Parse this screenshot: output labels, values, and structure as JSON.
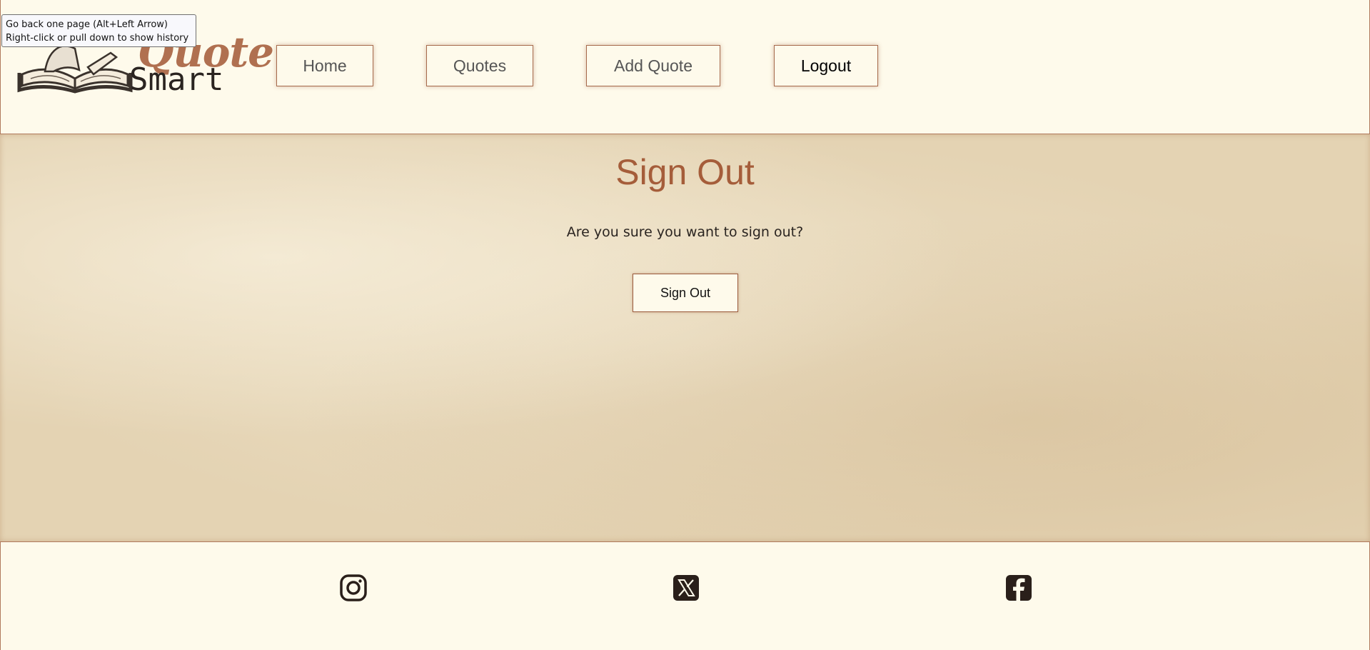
{
  "tooltip": {
    "line1": "Go back one page (Alt+Left Arrow)",
    "line2": "Right-click or pull down to show history"
  },
  "header": {
    "logo": {
      "word1": "Quote",
      "word2": "Smart",
      "icon": "open-book-icon"
    },
    "nav": [
      {
        "label": "Home"
      },
      {
        "label": "Quotes"
      },
      {
        "label": "Add Quote"
      },
      {
        "label": "Logout"
      }
    ]
  },
  "main": {
    "title": "Sign Out",
    "prompt": "Are you sure you want to sign out?",
    "button_label": "Sign Out"
  },
  "footer": {
    "social": [
      {
        "icon": "instagram-icon"
      },
      {
        "icon": "x-twitter-icon"
      },
      {
        "icon": "facebook-icon"
      }
    ]
  },
  "colors": {
    "accent": "#a55d3a",
    "border": "#a66a4c",
    "background": "#fefaeb",
    "parchment": "#e8d9bc",
    "text": "#2a2420"
  }
}
